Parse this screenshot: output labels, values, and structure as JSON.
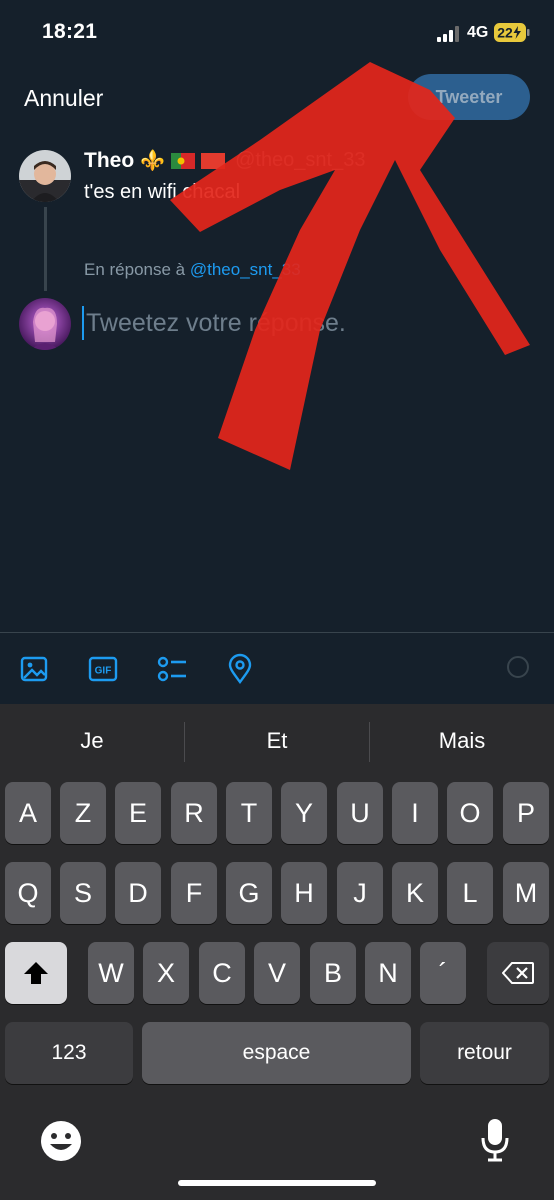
{
  "status_bar": {
    "time": "18:21",
    "network": "4G",
    "battery": "22"
  },
  "header": {
    "cancel_label": "Annuler",
    "tweet_label": "Tweeter"
  },
  "original_tweet": {
    "name": "Theo",
    "emoji": "⚜️",
    "handle": "@theo_snt_33",
    "text": "t'es en wifi chacal"
  },
  "reply": {
    "prefix": "En réponse à",
    "mention": "@theo_snt_33",
    "placeholder": "Tweetez votre réponse."
  },
  "toolbar": {
    "icons": [
      "image-icon",
      "gif-icon",
      "poll-icon",
      "location-icon"
    ],
    "gif_label": "GIF"
  },
  "keyboard": {
    "suggestions": [
      "Je",
      "Et",
      "Mais"
    ],
    "row1": [
      "A",
      "Z",
      "E",
      "R",
      "T",
      "Y",
      "U",
      "I",
      "O",
      "P"
    ],
    "row2": [
      "Q",
      "S",
      "D",
      "F",
      "G",
      "H",
      "J",
      "K",
      "L",
      "M"
    ],
    "row3": [
      "W",
      "X",
      "C",
      "V",
      "B",
      "N",
      "´"
    ],
    "numbers_label": "123",
    "space_label": "espace",
    "return_label": "retour"
  },
  "colors": {
    "background": "#15202b",
    "accent": "#1d9bf0",
    "scribble": "#e3261b"
  }
}
